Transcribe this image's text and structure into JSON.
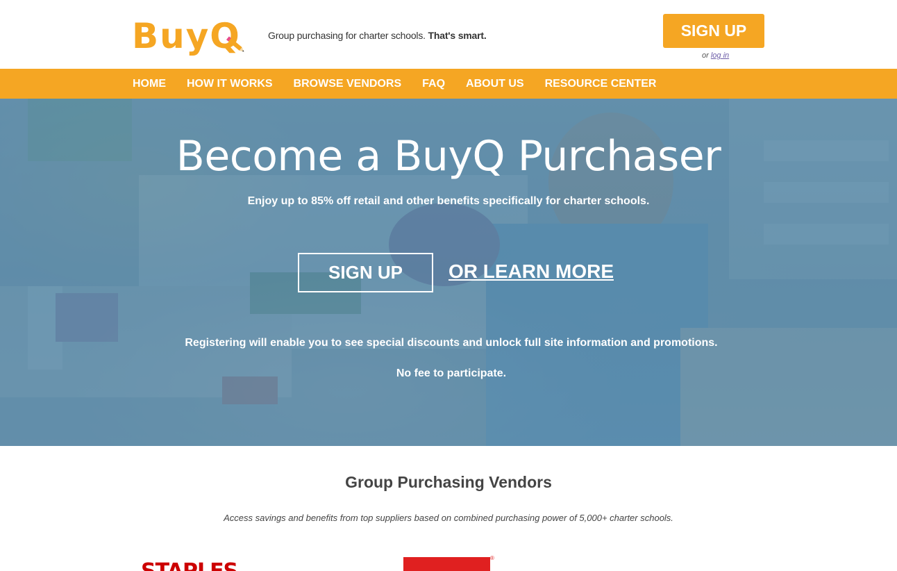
{
  "header": {
    "logo_text": "BuyQ",
    "tagline_regular": "Group purchasing for charter schools. ",
    "tagline_bold": "That's smart.",
    "signup_label": "SIGN UP",
    "login_prefix": "or ",
    "login_label": "log in"
  },
  "nav": {
    "items": [
      {
        "label": "HOME"
      },
      {
        "label": "HOW IT WORKS"
      },
      {
        "label": "BROWSE VENDORS"
      },
      {
        "label": "FAQ"
      },
      {
        "label": "ABOUT US"
      },
      {
        "label": "RESOURCE CENTER"
      }
    ]
  },
  "hero": {
    "title": "Become a BuyQ Purchaser",
    "subtitle": "Enjoy up to 85% off retail and other benefits specifically for charter schools.",
    "signup_label": "SIGN UP",
    "learn_more_label": "OR LEARN MORE",
    "note_register": "Registering will enable you to see special discounts and unlock full site information and promotions.",
    "note_fee": "No fee to participate."
  },
  "vendors": {
    "title": "Group Purchasing Vendors",
    "subtitle": "Access savings and benefits from top suppliers based on combined purchasing power of 5,000+ charter schools.",
    "logos": [
      {
        "name": "STAPLES"
      },
      {
        "registered_mark": "®"
      }
    ]
  },
  "colors": {
    "brand_orange": "#f5a623",
    "hero_overlay": "#467da0",
    "staples_red": "#cc0000"
  },
  "icons": {
    "logo_pencil": "pencil-icon"
  }
}
